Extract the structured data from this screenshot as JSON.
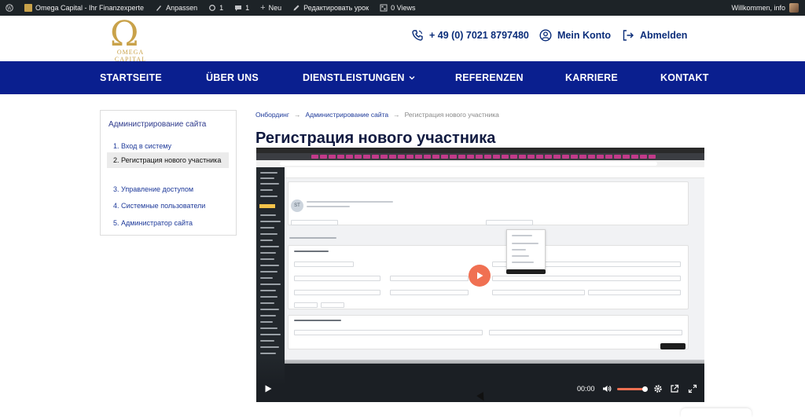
{
  "adminbar": {
    "site_name": "Omega Capital - Ihr Finanzexperte",
    "customize": "Anpassen",
    "updates_count": "1",
    "comments_count": "1",
    "new": "Neu",
    "edit": "Редактировать урок",
    "views": "0 Views",
    "greeting": "Willkommen, info"
  },
  "header": {
    "logo_text": "OMEGA CAPITAL",
    "phone": "+ 49 (0) 7021 8797480",
    "account": "Mein Konto",
    "logout": "Abmelden"
  },
  "nav": {
    "items": [
      "STARTSEITE",
      "ÜBER UNS",
      "DIENSTLEISTUNGEN",
      "REFERENZEN",
      "KARRIERE",
      "KONTAKT"
    ]
  },
  "sidebar": {
    "title": "Администрирование сайта",
    "items": [
      "1. Вход в систему",
      "2. Регистрация нового участника",
      "3. Управление доступом",
      "4. Системные пользователи",
      "5. Администратор сайта"
    ]
  },
  "breadcrumbs": {
    "items": [
      "Онбординг",
      "Администрирование сайта",
      "Регистрация нового участника"
    ]
  },
  "page": {
    "title": "Регистрация нового участника"
  },
  "video": {
    "time": "00:00",
    "avatar_initials": "ST",
    "volume_level": 0.95,
    "accent": "#f07052"
  }
}
